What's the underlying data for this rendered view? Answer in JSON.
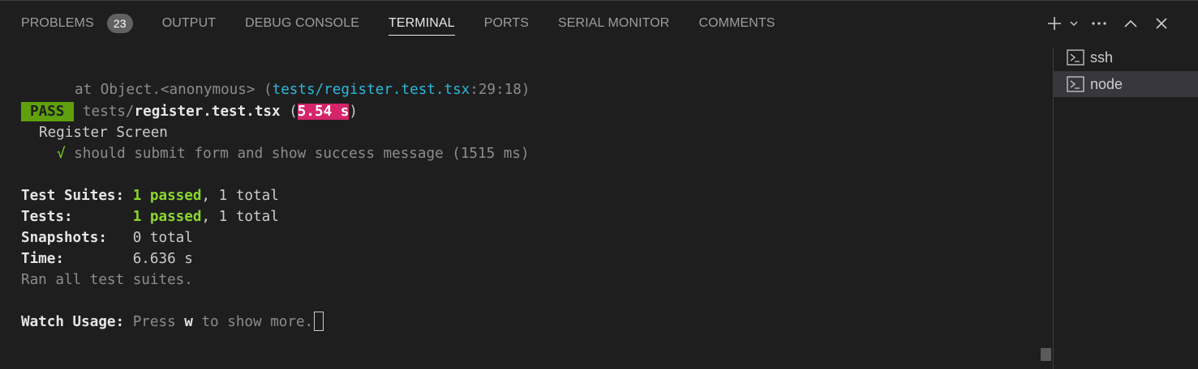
{
  "tabs": [
    {
      "label": "PROBLEMS",
      "badge": "23"
    },
    {
      "label": "OUTPUT"
    },
    {
      "label": "DEBUG CONSOLE"
    },
    {
      "label": "TERMINAL",
      "active": true
    },
    {
      "label": "PORTS"
    },
    {
      "label": "SERIAL MONITOR"
    },
    {
      "label": "COMMENTS"
    }
  ],
  "toolbar": {
    "icons": [
      "plus-icon",
      "chevron-down-icon",
      "ellipsis-icon",
      "chevron-up-icon",
      "close-icon"
    ]
  },
  "terminal": {
    "stack_prefix": "at Object.<anonymous> (",
    "stack_file": "tests/register.test.tsx",
    "stack_pos": ":29:18",
    "stack_suffix": ")",
    "pass_label": "PASS",
    "test_dir": "tests/",
    "test_file": "register.test.tsx",
    "test_time": "5.54 s",
    "describe": "Register Screen",
    "check_mark": "√",
    "test_name": "should submit form and show success message (1515 ms)",
    "summary": [
      {
        "label": "Test Suites:",
        "passed": "1 passed",
        "rest": ", 1 total"
      },
      {
        "label": "Tests:",
        "passed": "1 passed",
        "rest": ", 1 total"
      },
      {
        "label": "Snapshots:",
        "value": "0 total"
      },
      {
        "label": "Time:",
        "value": "6.636 s"
      }
    ],
    "ran_all": "Ran all test suites.",
    "watch_label": "Watch Usage:",
    "watch_press": "Press",
    "watch_key": "w",
    "watch_rest": "to show more."
  },
  "terminals": [
    {
      "name": "ssh",
      "icon": "terminal-icon"
    },
    {
      "name": "node",
      "icon": "terminal-icon",
      "selected": true
    }
  ],
  "colors": {
    "background": "#1e1e1e",
    "pass": "#5fa00c",
    "slow_time": "#d6246a",
    "green": "#8bd72e",
    "cyan": "#29b8db"
  }
}
